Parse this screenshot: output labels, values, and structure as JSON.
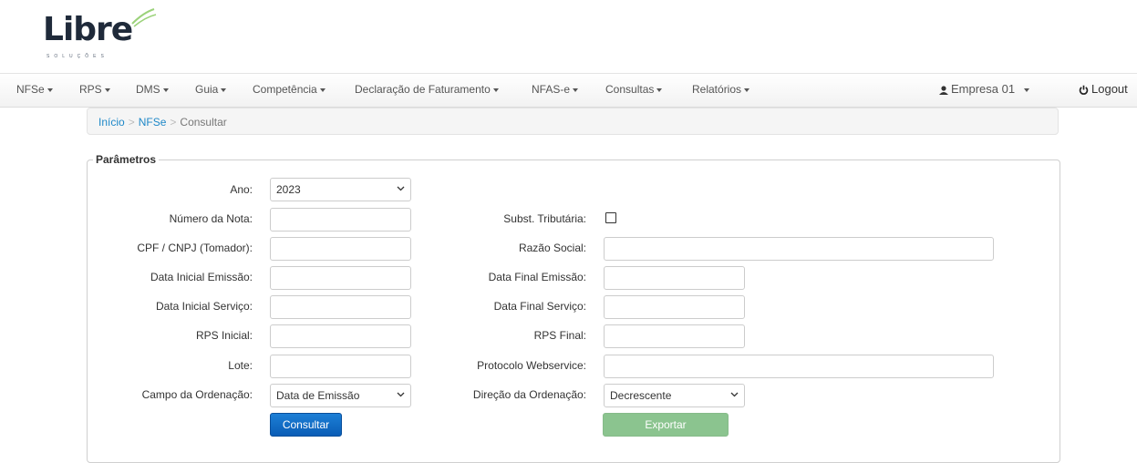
{
  "logo": {
    "text": "Libre",
    "tagline": "SOLUÇÕES"
  },
  "navbar": {
    "items": [
      "NFSe",
      "RPS",
      "DMS",
      "Guia",
      "Competência",
      "Declaração de Faturamento",
      "NFAS-e",
      "Consultas",
      "Relatórios"
    ],
    "user": "Empresa 01",
    "logout": "Logout"
  },
  "breadcrumb": {
    "home": "Início",
    "section": "NFSe",
    "current": "Consultar"
  },
  "form": {
    "legend": "Parâmetros",
    "ano": {
      "label": "Ano:",
      "value": "2023"
    },
    "numero_nota": {
      "label": "Número da Nota:",
      "value": ""
    },
    "subst_tributaria": {
      "label": "Subst. Tributária:",
      "checked": false
    },
    "cpf_cnpj": {
      "label": "CPF / CNPJ (Tomador):",
      "value": ""
    },
    "razao_social": {
      "label": "Razão Social:",
      "value": ""
    },
    "data_inicial_emissao": {
      "label": "Data Inicial Emissão:",
      "value": ""
    },
    "data_final_emissao": {
      "label": "Data Final Emissão:",
      "value": ""
    },
    "data_inicial_servico": {
      "label": "Data Inicial Serviço:",
      "value": ""
    },
    "data_final_servico": {
      "label": "Data Final Serviço:",
      "value": ""
    },
    "rps_inicial": {
      "label": "RPS Inicial:",
      "value": ""
    },
    "rps_final": {
      "label": "RPS Final:",
      "value": ""
    },
    "lote": {
      "label": "Lote:",
      "value": ""
    },
    "protocolo": {
      "label": "Protocolo Webservice:",
      "value": ""
    },
    "campo_ordenacao": {
      "label": "Campo da Ordenação:",
      "value": "Data de Emissão"
    },
    "direcao_ordenacao": {
      "label": "Direção da Ordenação:",
      "value": "Decrescente"
    },
    "consultar": "Consultar",
    "exportar": "Exportar"
  },
  "colors": {
    "link": "#1e88c8",
    "primary": "#0a5db6",
    "success_disabled": "#8bc48f"
  },
  "icons": [
    "user-icon",
    "power-icon",
    "chevron-down-icon",
    "caret-down-icon"
  ]
}
